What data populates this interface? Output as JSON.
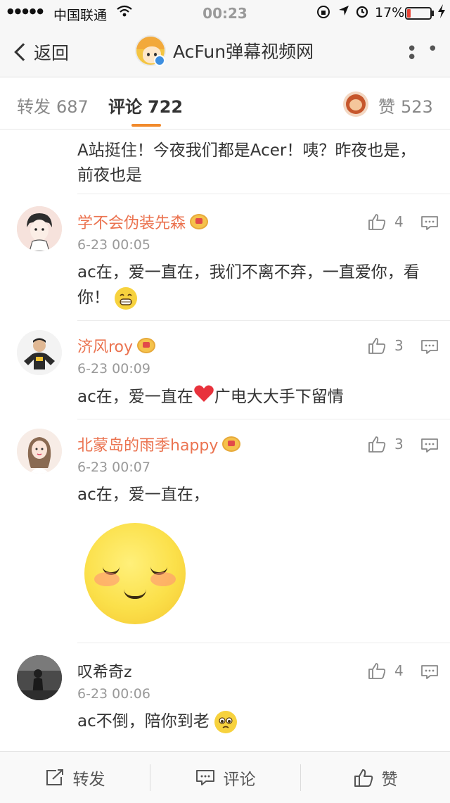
{
  "status_bar": {
    "signal": "●●●●●",
    "carrier": "中国联通",
    "time": "00:23",
    "battery": "17%",
    "battery_level": 0.17,
    "battery_color": "#e94335"
  },
  "nav": {
    "back_label": "返回",
    "title": "AcFun弹幕视频网",
    "more_icon": "more-dots-icon"
  },
  "tabs": {
    "repost": {
      "label": "转发",
      "count": "687"
    },
    "comment": {
      "label": "评论",
      "count": "722"
    },
    "like": {
      "label": "赞",
      "count": "523"
    }
  },
  "top_fragment": "A站挺住！今夜我们都是Acer！咦？昨夜也是，前夜也是",
  "comments": [
    {
      "user": "学不会伪装先森",
      "time": "6-23 00:05",
      "text": "ac在，爱一直在，我们不离不弃，一直爱你，看你！",
      "likes": "4",
      "vip": true,
      "emoji": "grin-emoji"
    },
    {
      "user": "济风roy",
      "time": "6-23 00:09",
      "text_before": "ac在，爱一直在",
      "text_after": "广电大大手下留情",
      "likes": "3",
      "vip": true,
      "emoji": "red-heart-emoji"
    },
    {
      "user": "北蒙岛的雨季happy",
      "time": "6-23 00:07",
      "text": "ac在，爱一直在，",
      "likes": "3",
      "vip": true,
      "sticker": "shy-blush-sticker"
    },
    {
      "user": "叹希奇z",
      "time": "6-23 00:06",
      "text": "ac不倒，陪你到老",
      "likes": "4",
      "vip": false,
      "emoji": "pleading-emoji"
    }
  ],
  "bottom_bar": {
    "repost": "转发",
    "comment": "评论",
    "like": "赞"
  },
  "colors": {
    "accent": "#f18a2c",
    "username": "#eb7350"
  }
}
